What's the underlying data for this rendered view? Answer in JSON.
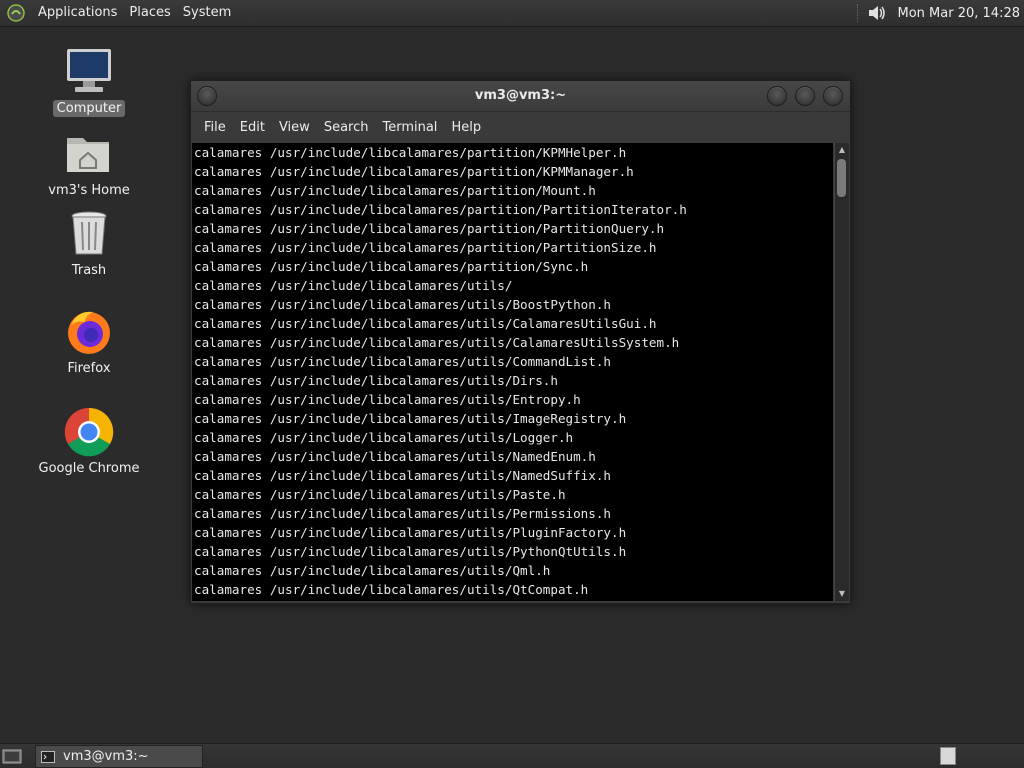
{
  "top_panel": {
    "menus": [
      "Applications",
      "Places",
      "System"
    ],
    "clock": "Mon Mar 20, 14:28"
  },
  "desktop": {
    "icons": [
      {
        "label": "Computer"
      },
      {
        "label": "vm3's Home"
      },
      {
        "label": "Trash"
      },
      {
        "label": "Firefox"
      },
      {
        "label": "Google Chrome"
      }
    ]
  },
  "terminal": {
    "title": "vm3@vm3:~",
    "menu": [
      "File",
      "Edit",
      "View",
      "Search",
      "Terminal",
      "Help"
    ],
    "lines": [
      "calamares /usr/include/libcalamares/partition/KPMHelper.h",
      "calamares /usr/include/libcalamares/partition/KPMManager.h",
      "calamares /usr/include/libcalamares/partition/Mount.h",
      "calamares /usr/include/libcalamares/partition/PartitionIterator.h",
      "calamares /usr/include/libcalamares/partition/PartitionQuery.h",
      "calamares /usr/include/libcalamares/partition/PartitionSize.h",
      "calamares /usr/include/libcalamares/partition/Sync.h",
      "calamares /usr/include/libcalamares/utils/",
      "calamares /usr/include/libcalamares/utils/BoostPython.h",
      "calamares /usr/include/libcalamares/utils/CalamaresUtilsGui.h",
      "calamares /usr/include/libcalamares/utils/CalamaresUtilsSystem.h",
      "calamares /usr/include/libcalamares/utils/CommandList.h",
      "calamares /usr/include/libcalamares/utils/Dirs.h",
      "calamares /usr/include/libcalamares/utils/Entropy.h",
      "calamares /usr/include/libcalamares/utils/ImageRegistry.h",
      "calamares /usr/include/libcalamares/utils/Logger.h",
      "calamares /usr/include/libcalamares/utils/NamedEnum.h",
      "calamares /usr/include/libcalamares/utils/NamedSuffix.h",
      "calamares /usr/include/libcalamares/utils/Paste.h",
      "calamares /usr/include/libcalamares/utils/Permissions.h",
      "calamares /usr/include/libcalamares/utils/PluginFactory.h",
      "calamares /usr/include/libcalamares/utils/PythonQtUtils.h",
      "calamares /usr/include/libcalamares/utils/Qml.h",
      "calamares /usr/include/libcalamares/utils/QtCompat.h"
    ]
  },
  "taskbar": {
    "task_label": "vm3@vm3:~"
  }
}
